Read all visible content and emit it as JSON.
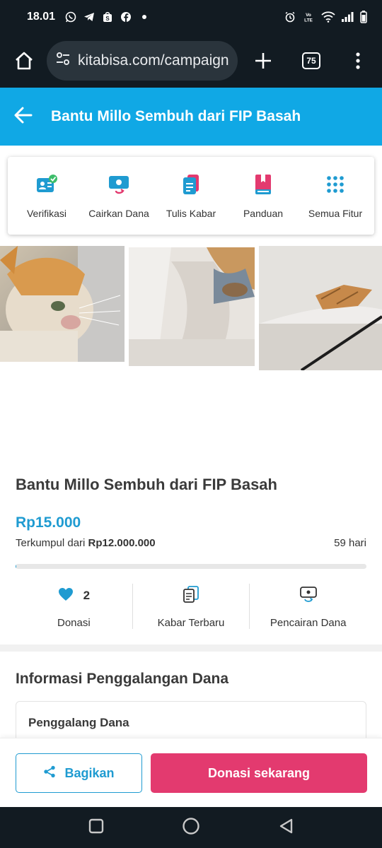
{
  "status_bar": {
    "time": "18.01",
    "left_icons": [
      "whatsapp-icon",
      "telegram-icon",
      "shopee-icon",
      "facebook-icon",
      "dot-icon"
    ],
    "right_icons": [
      "alarm-icon",
      "volte-icon",
      "wifi-icon",
      "signal-icon",
      "battery-icon"
    ],
    "volte_label": "Vo LTE"
  },
  "browser": {
    "url": "kitabisa.com/campaign",
    "tab_count": "75"
  },
  "header": {
    "title": "Bantu Millo Sembuh dari FIP Basah",
    "color": "#10a8e5"
  },
  "features": [
    {
      "label": "Verifikasi",
      "icon": "verification-icon"
    },
    {
      "label": "Cairkan Dana",
      "icon": "disburse-funds-icon"
    },
    {
      "label": "Tulis Kabar",
      "icon": "write-update-icon"
    },
    {
      "label": "Panduan",
      "icon": "guide-book-icon"
    },
    {
      "label": "Semua Fitur",
      "icon": "grid-icon"
    }
  ],
  "campaign": {
    "title": "Bantu Millo Sembuh dari FIP Basah",
    "amount": "Rp15.000",
    "collected_prefix": "Terkumpul dari",
    "target": "Rp12.000.000",
    "days_left": "59 hari",
    "progress_fraction": 0.00125
  },
  "stats": {
    "donations_count": "2",
    "donations_label": "Donasi",
    "updates_label": "Kabar Terbaru",
    "disbursement_label": "Pencairan Dana"
  },
  "info": {
    "section_title": "Informasi Penggalangan Dana",
    "fundraiser_label": "Penggalang Dana"
  },
  "actions": {
    "share_label": "Bagikan",
    "donate_label": "Donasi sekarang",
    "accent": "#1f9bd1",
    "donate_color": "#e33a6f"
  }
}
